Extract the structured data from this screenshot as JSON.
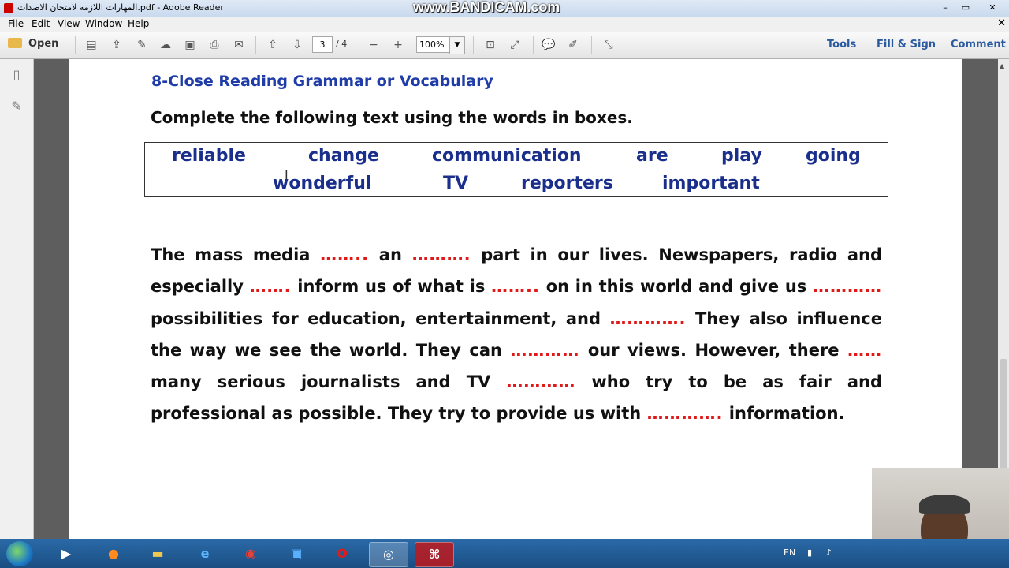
{
  "window": {
    "title": "المهارات اللازمه لامتحان الاصدات.pdf - Adobe Reader",
    "watermark": "www.BANDICAM.com",
    "controls": {
      "minimize": "–",
      "maximize": "▭",
      "close": "✕"
    }
  },
  "menu": {
    "items": [
      "File",
      "Edit",
      "View",
      "Window",
      "Help"
    ],
    "close_glyph": "✕"
  },
  "toolbar": {
    "open_label": "Open",
    "page_current": "3",
    "page_total": "/ 4",
    "zoom": "100%",
    "zoom_arrow": "▼",
    "right": {
      "tools": "Tools",
      "fill_sign": "Fill & Sign",
      "comment": "Comment"
    },
    "icons": {
      "create": "▤",
      "export": "⇪",
      "edit": "✎",
      "cloud": "☁",
      "save": "▣",
      "print": "⎙",
      "email": "✉",
      "prev": "⇧",
      "next": "⇩",
      "minus": "−",
      "plus": "+",
      "fit_page": "⊡",
      "fit_width": "⤢",
      "comment": "💬",
      "highlight": "✐",
      "expand": "⤡"
    }
  },
  "leftnav": {
    "pages_icon": "▯",
    "attach_icon": "✎"
  },
  "document": {
    "heading": "8-Close Reading Grammar or Vocabulary",
    "instruction": "Complete the following text using the words in boxes.",
    "words": [
      "reliable",
      "change",
      "communication",
      "are",
      "play",
      "going",
      "wonderful",
      "TV",
      "reporters",
      "important"
    ],
    "passage": {
      "s1": "The mass media ",
      "b1": "……..",
      "s2": " an ",
      "b2": "……….",
      "s3": " part in our lives. Newspapers, radio and especially ",
      "b3": "…….",
      "s4": " inform us of what is ",
      "b4": "……..",
      "s5": " on in this world and give us ",
      "b5": "…………",
      "s6": " possibilities for education, entertainment, and ",
      "b6": "………….",
      "s7": " They also influence the way we see the world. They can ",
      "b7": "…………",
      "s8": " our views. However, there ",
      "b8": "……",
      "s9": " many serious journalists and TV ",
      "b9": "…………",
      "s10": " who try to be as fair and professional as possible. They try to provide us with ",
      "b10": "………….",
      "s11": " information."
    }
  },
  "taskbar": {
    "tray_lang": "EN",
    "colors": {
      "accent": "#1f3ca8",
      "blank": "#e01818",
      "taskbar": "#1b4e82"
    }
  }
}
